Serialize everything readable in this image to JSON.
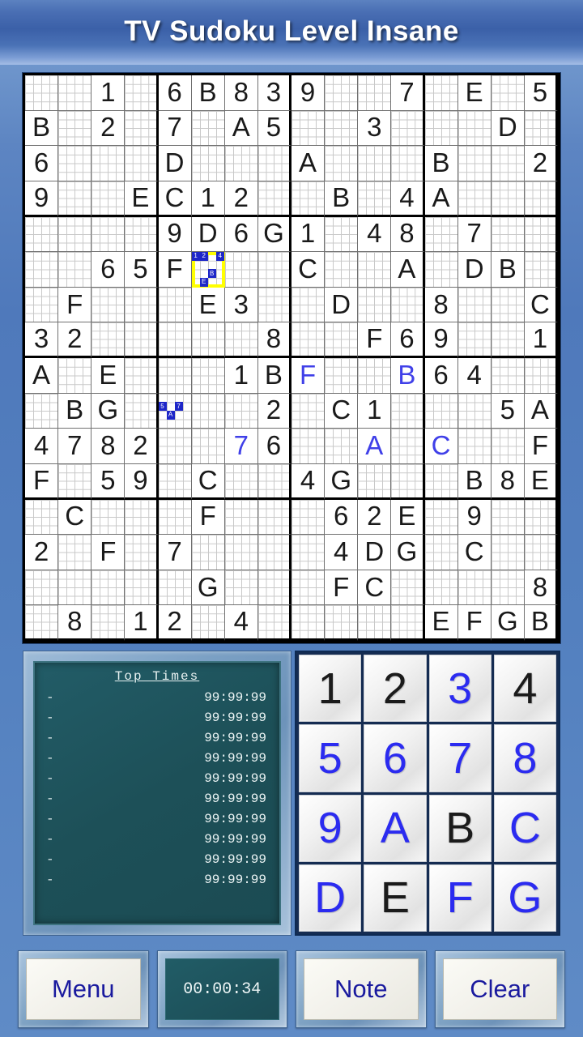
{
  "app": {
    "title": "TV Sudoku Level Insane"
  },
  "board": {
    "size": 16,
    "box_rows": 4,
    "box_cols": 4,
    "selected_cell": {
      "row": 5,
      "col": 5
    },
    "symbols": [
      "1",
      "2",
      "3",
      "4",
      "5",
      "6",
      "7",
      "8",
      "9",
      "A",
      "B",
      "C",
      "D",
      "E",
      "F",
      "G"
    ],
    "rows": [
      [
        {
          "v": ""
        },
        {
          "v": ""
        },
        {
          "v": "1"
        },
        {
          "v": ""
        },
        {
          "v": "6"
        },
        {
          "v": "B"
        },
        {
          "v": "8"
        },
        {
          "v": "3"
        },
        {
          "v": "9"
        },
        {
          "v": ""
        },
        {
          "v": ""
        },
        {
          "v": "7"
        },
        {
          "v": ""
        },
        {
          "v": "E"
        },
        {
          "v": ""
        },
        {
          "v": "5"
        }
      ],
      [
        {
          "v": "B"
        },
        {
          "v": ""
        },
        {
          "v": "2"
        },
        {
          "v": ""
        },
        {
          "v": "7"
        },
        {
          "v": ""
        },
        {
          "v": "A"
        },
        {
          "v": "5"
        },
        {
          "v": ""
        },
        {
          "v": ""
        },
        {
          "v": "3"
        },
        {
          "v": ""
        },
        {
          "v": ""
        },
        {
          "v": ""
        },
        {
          "v": "D"
        },
        {
          "v": ""
        }
      ],
      [
        {
          "v": "6"
        },
        {
          "v": ""
        },
        {
          "v": ""
        },
        {
          "v": ""
        },
        {
          "v": "D"
        },
        {
          "v": ""
        },
        {
          "v": ""
        },
        {
          "v": ""
        },
        {
          "v": "A"
        },
        {
          "v": ""
        },
        {
          "v": ""
        },
        {
          "v": ""
        },
        {
          "v": "B"
        },
        {
          "v": ""
        },
        {
          "v": ""
        },
        {
          "v": "2"
        }
      ],
      [
        {
          "v": "9"
        },
        {
          "v": ""
        },
        {
          "v": ""
        },
        {
          "v": "E"
        },
        {
          "v": "C"
        },
        {
          "v": "1"
        },
        {
          "v": "2"
        },
        {
          "v": ""
        },
        {
          "v": ""
        },
        {
          "v": "B"
        },
        {
          "v": ""
        },
        {
          "v": "4"
        },
        {
          "v": "A"
        },
        {
          "v": ""
        },
        {
          "v": ""
        },
        {
          "v": ""
        }
      ],
      [
        {
          "v": ""
        },
        {
          "v": ""
        },
        {
          "v": ""
        },
        {
          "v": ""
        },
        {
          "v": "9"
        },
        {
          "v": "D"
        },
        {
          "v": "6"
        },
        {
          "v": "G"
        },
        {
          "v": "1"
        },
        {
          "v": ""
        },
        {
          "v": "4"
        },
        {
          "v": "8"
        },
        {
          "v": ""
        },
        {
          "v": "7"
        },
        {
          "v": ""
        },
        {
          "v": ""
        }
      ],
      [
        {
          "v": ""
        },
        {
          "v": ""
        },
        {
          "v": "6"
        },
        {
          "v": "5"
        },
        {
          "v": "F"
        },
        {
          "v": "",
          "notes": [
            1,
            2,
            4,
            11,
            14
          ]
        },
        {
          "v": ""
        },
        {
          "v": ""
        },
        {
          "v": "C"
        },
        {
          "v": ""
        },
        {
          "v": ""
        },
        {
          "v": "A"
        },
        {
          "v": ""
        },
        {
          "v": "D"
        },
        {
          "v": "B"
        },
        {
          "v": ""
        }
      ],
      [
        {
          "v": ""
        },
        {
          "v": "F"
        },
        {
          "v": ""
        },
        {
          "v": ""
        },
        {
          "v": ""
        },
        {
          "v": "E"
        },
        {
          "v": "3"
        },
        {
          "v": ""
        },
        {
          "v": ""
        },
        {
          "v": "D"
        },
        {
          "v": ""
        },
        {
          "v": ""
        },
        {
          "v": "8"
        },
        {
          "v": ""
        },
        {
          "v": ""
        },
        {
          "v": "C"
        }
      ],
      [
        {
          "v": "3"
        },
        {
          "v": "2"
        },
        {
          "v": ""
        },
        {
          "v": ""
        },
        {
          "v": ""
        },
        {
          "v": ""
        },
        {
          "v": ""
        },
        {
          "v": "8"
        },
        {
          "v": ""
        },
        {
          "v": ""
        },
        {
          "v": "F"
        },
        {
          "v": "6"
        },
        {
          "v": "9"
        },
        {
          "v": ""
        },
        {
          "v": ""
        },
        {
          "v": "1"
        }
      ],
      [
        {
          "v": "A"
        },
        {
          "v": ""
        },
        {
          "v": "E"
        },
        {
          "v": ""
        },
        {
          "v": ""
        },
        {
          "v": ""
        },
        {
          "v": "1"
        },
        {
          "v": "B"
        },
        {
          "v": "F",
          "user": true
        },
        {
          "v": ""
        },
        {
          "v": ""
        },
        {
          "v": "B",
          "user": true
        },
        {
          "v": "6"
        },
        {
          "v": "4"
        },
        {
          "v": ""
        },
        {
          "v": ""
        }
      ],
      [
        {
          "v": ""
        },
        {
          "v": "B"
        },
        {
          "v": "G"
        },
        {
          "v": ""
        },
        {
          "v": "",
          "notes": [
            5,
            7,
            10
          ]
        },
        {
          "v": ""
        },
        {
          "v": ""
        },
        {
          "v": "2"
        },
        {
          "v": ""
        },
        {
          "v": "C"
        },
        {
          "v": "1"
        },
        {
          "v": ""
        },
        {
          "v": ""
        },
        {
          "v": ""
        },
        {
          "v": "5"
        },
        {
          "v": "A"
        }
      ],
      [
        {
          "v": "4"
        },
        {
          "v": "7"
        },
        {
          "v": "8"
        },
        {
          "v": "2"
        },
        {
          "v": ""
        },
        {
          "v": ""
        },
        {
          "v": "7",
          "user": true
        },
        {
          "v": "6"
        },
        {
          "v": ""
        },
        {
          "v": ""
        },
        {
          "v": "A",
          "user": true
        },
        {
          "v": ""
        },
        {
          "v": "C",
          "user": true
        },
        {
          "v": ""
        },
        {
          "v": ""
        },
        {
          "v": "F"
        }
      ],
      [
        {
          "v": "F"
        },
        {
          "v": ""
        },
        {
          "v": "5"
        },
        {
          "v": "9"
        },
        {
          "v": ""
        },
        {
          "v": "C"
        },
        {
          "v": ""
        },
        {
          "v": ""
        },
        {
          "v": "4"
        },
        {
          "v": "G"
        },
        {
          "v": ""
        },
        {
          "v": ""
        },
        {
          "v": ""
        },
        {
          "v": "B"
        },
        {
          "v": "8"
        },
        {
          "v": "E"
        }
      ],
      [
        {
          "v": ""
        },
        {
          "v": "C"
        },
        {
          "v": ""
        },
        {
          "v": ""
        },
        {
          "v": ""
        },
        {
          "v": "F"
        },
        {
          "v": ""
        },
        {
          "v": ""
        },
        {
          "v": ""
        },
        {
          "v": "6"
        },
        {
          "v": "2"
        },
        {
          "v": "E"
        },
        {
          "v": ""
        },
        {
          "v": "9"
        },
        {
          "v": ""
        },
        {
          "v": ""
        }
      ],
      [
        {
          "v": "2"
        },
        {
          "v": ""
        },
        {
          "v": "F"
        },
        {
          "v": ""
        },
        {
          "v": "7"
        },
        {
          "v": ""
        },
        {
          "v": ""
        },
        {
          "v": ""
        },
        {
          "v": ""
        },
        {
          "v": "4"
        },
        {
          "v": "D"
        },
        {
          "v": "G"
        },
        {
          "v": ""
        },
        {
          "v": "C"
        },
        {
          "v": ""
        },
        {
          "v": ""
        }
      ],
      [
        {
          "v": ""
        },
        {
          "v": ""
        },
        {
          "v": ""
        },
        {
          "v": ""
        },
        {
          "v": ""
        },
        {
          "v": "G"
        },
        {
          "v": ""
        },
        {
          "v": ""
        },
        {
          "v": ""
        },
        {
          "v": "F"
        },
        {
          "v": "C"
        },
        {
          "v": ""
        },
        {
          "v": ""
        },
        {
          "v": ""
        },
        {
          "v": ""
        },
        {
          "v": "8"
        }
      ],
      [
        {
          "v": ""
        },
        {
          "v": "8"
        },
        {
          "v": ""
        },
        {
          "v": "1"
        },
        {
          "v": "2"
        },
        {
          "v": ""
        },
        {
          "v": "4"
        },
        {
          "v": ""
        },
        {
          "v": ""
        },
        {
          "v": ""
        },
        {
          "v": ""
        },
        {
          "v": ""
        },
        {
          "v": "E"
        },
        {
          "v": "F"
        },
        {
          "v": "G"
        },
        {
          "v": "B"
        }
      ]
    ]
  },
  "top_times": {
    "title": "Top Times",
    "entries": [
      {
        "name": "-",
        "time": "99:99:99"
      },
      {
        "name": "-",
        "time": "99:99:99"
      },
      {
        "name": "-",
        "time": "99:99:99"
      },
      {
        "name": "-",
        "time": "99:99:99"
      },
      {
        "name": "-",
        "time": "99:99:99"
      },
      {
        "name": "-",
        "time": "99:99:99"
      },
      {
        "name": "-",
        "time": "99:99:99"
      },
      {
        "name": "-",
        "time": "99:99:99"
      },
      {
        "name": "-",
        "time": "99:99:99"
      },
      {
        "name": "-",
        "time": "99:99:99"
      }
    ]
  },
  "keypad": {
    "keys": [
      {
        "label": "1",
        "color": "dark"
      },
      {
        "label": "2",
        "color": "dark"
      },
      {
        "label": "3",
        "color": "blue"
      },
      {
        "label": "4",
        "color": "dark"
      },
      {
        "label": "5",
        "color": "blue"
      },
      {
        "label": "6",
        "color": "blue"
      },
      {
        "label": "7",
        "color": "blue"
      },
      {
        "label": "8",
        "color": "blue"
      },
      {
        "label": "9",
        "color": "blue"
      },
      {
        "label": "A",
        "color": "blue"
      },
      {
        "label": "B",
        "color": "dark"
      },
      {
        "label": "C",
        "color": "blue"
      },
      {
        "label": "D",
        "color": "blue"
      },
      {
        "label": "E",
        "color": "dark"
      },
      {
        "label": "F",
        "color": "blue"
      },
      {
        "label": "G",
        "color": "blue"
      }
    ]
  },
  "bottom": {
    "menu_label": "Menu",
    "timer_value": "00:00:34",
    "note_label": "Note",
    "clear_label": "Clear"
  },
  "colors": {
    "user_value": "#4040e8",
    "given_value": "#1a1a1a",
    "selection": "#ffff00",
    "note_mark": "#1e27c8",
    "panel_teal": "#1f5560",
    "button_text": "#1a1a9e"
  }
}
